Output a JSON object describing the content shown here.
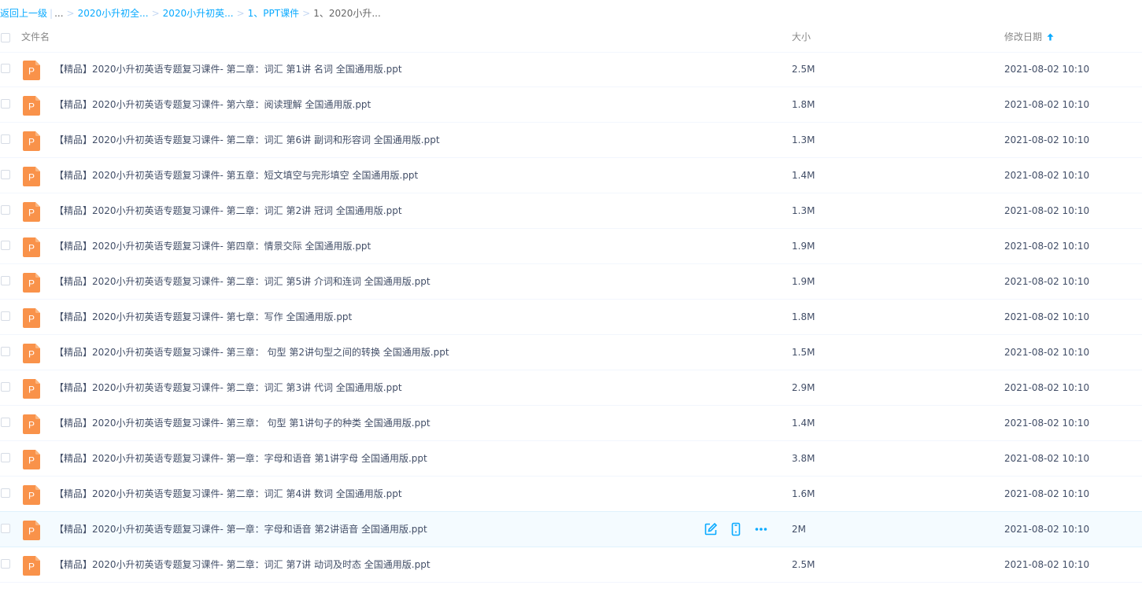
{
  "breadcrumb": {
    "back_label": "返回上一级",
    "separator_bar": "|",
    "ellipsis": "...",
    "crumbs": [
      "2020小升初全...",
      "2020小升初英...",
      "1、PPT课件"
    ],
    "current": "1、2020小升...",
    "arrow": ">"
  },
  "header": {
    "name_label": "文件名",
    "size_label": "大小",
    "date_label": "修改日期",
    "sort_icon": "arrow-up-icon"
  },
  "colors": {
    "accent": "#09aaff",
    "ppt_icon": "#f9924a",
    "hover_row": "#f4fbff"
  },
  "file_icon": {
    "letter": "P",
    "name": "ppt-file-icon"
  },
  "hover_actions": [
    "edit-icon",
    "mobile-icon",
    "more-icon"
  ],
  "files": [
    {
      "name": "【精品】2020小升初英语专题复习课件- 第二章：词汇 第1讲 名词 全国通用版.ppt",
      "size": "2.5M",
      "date": "2021-08-02 10:10"
    },
    {
      "name": "【精品】2020小升初英语专题复习课件- 第六章：阅读理解 全国通用版.ppt",
      "size": "1.8M",
      "date": "2021-08-02 10:10"
    },
    {
      "name": "【精品】2020小升初英语专题复习课件- 第二章：词汇 第6讲 副词和形容词 全国通用版.ppt",
      "size": "1.3M",
      "date": "2021-08-02 10:10"
    },
    {
      "name": "【精品】2020小升初英语专题复习课件- 第五章：短文填空与完形填空 全国通用版.ppt",
      "size": "1.4M",
      "date": "2021-08-02 10:10"
    },
    {
      "name": "【精品】2020小升初英语专题复习课件- 第二章：词汇 第2讲 冠词 全国通用版.ppt",
      "size": "1.3M",
      "date": "2021-08-02 10:10"
    },
    {
      "name": "【精品】2020小升初英语专题复习课件- 第四章：情景交际 全国通用版.ppt",
      "size": "1.9M",
      "date": "2021-08-02 10:10"
    },
    {
      "name": "【精品】2020小升初英语专题复习课件- 第二章：词汇 第5讲 介词和连词 全国通用版.ppt",
      "size": "1.9M",
      "date": "2021-08-02 10:10"
    },
    {
      "name": "【精品】2020小升初英语专题复习课件- 第七章：写作 全国通用版.ppt",
      "size": "1.8M",
      "date": "2021-08-02 10:10"
    },
    {
      "name": "【精品】2020小升初英语专题复习课件- 第三章： 句型 第2讲句型之间的转换 全国通用版.ppt",
      "size": "1.5M",
      "date": "2021-08-02 10:10"
    },
    {
      "name": "【精品】2020小升初英语专题复习课件- 第二章：词汇 第3讲 代词 全国通用版.ppt",
      "size": "2.9M",
      "date": "2021-08-02 10:10"
    },
    {
      "name": "【精品】2020小升初英语专题复习课件- 第三章： 句型 第1讲句子的种类 全国通用版.ppt",
      "size": "1.4M",
      "date": "2021-08-02 10:10"
    },
    {
      "name": "【精品】2020小升初英语专题复习课件- 第一章：字母和语音 第1讲字母 全国通用版.ppt",
      "size": "3.8M",
      "date": "2021-08-02 10:10"
    },
    {
      "name": "【精品】2020小升初英语专题复习课件- 第二章：词汇 第4讲 数词 全国通用版.ppt",
      "size": "1.6M",
      "date": "2021-08-02 10:10"
    },
    {
      "name": "【精品】2020小升初英语专题复习课件- 第一章：字母和语音 第2讲语音 全国通用版.ppt",
      "size": "2M",
      "date": "2021-08-02 10:10",
      "hovered": true
    },
    {
      "name": "【精品】2020小升初英语专题复习课件- 第二章：词汇 第7讲 动词及时态 全国通用版.ppt",
      "size": "2.5M",
      "date": "2021-08-02 10:10"
    }
  ]
}
